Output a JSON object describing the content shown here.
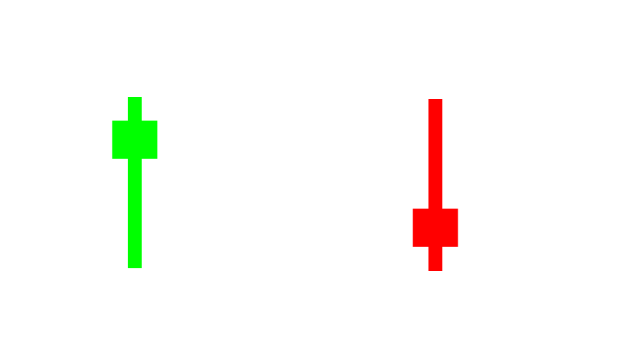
{
  "chart_data": {
    "type": "candlestick",
    "grid": false,
    "axes_visible": false,
    "ylim": [
      0,
      505
    ],
    "series": [
      {
        "candles": [
          {
            "open": 276,
            "close": 331,
            "high": 365,
            "low": 118,
            "direction": "up",
            "color": "#00ff00"
          },
          {
            "open": 204,
            "close": 149,
            "high": 362,
            "low": 114,
            "direction": "down",
            "color": "#ff0000"
          }
        ]
      }
    ]
  }
}
